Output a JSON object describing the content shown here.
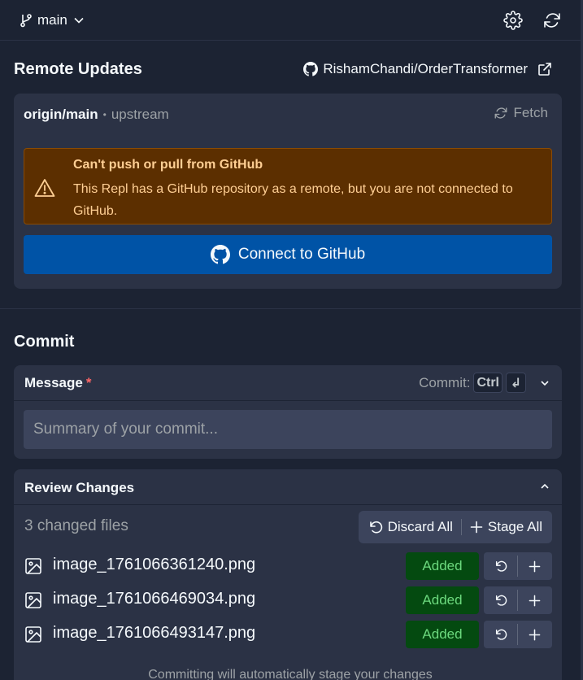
{
  "topbar": {
    "branch_name": "main",
    "icons": [
      "git-branch-icon",
      "chevron-down-icon",
      "gear-icon",
      "refresh-icon"
    ]
  },
  "remote": {
    "title": "Remote Updates",
    "repo_link": "RishamChandi/OrderTransformer",
    "origin": "origin/main",
    "separator": "•",
    "upstream": "upstream",
    "fetch_label": "Fetch",
    "warning_title": "Can't push or pull from GitHub",
    "warning_body": "This Repl has a GitHub repository as a remote, but you are not connected to GitHub.",
    "connect_label": "Connect to GitHub"
  },
  "commit": {
    "title": "Commit",
    "message_label": "Message",
    "required_mark": "*",
    "commit_hint": "Commit:",
    "shortcut_key": "Ctrl",
    "shortcut_enter": "↲",
    "message_placeholder": "Summary of your commit..."
  },
  "review": {
    "title": "Review Changes",
    "changed_count": "3 changed files",
    "discard_all": "Discard All",
    "stage_all": "Stage All",
    "files": [
      {
        "name": "image_1761066361240.png",
        "status": "Added"
      },
      {
        "name": "image_1761066469034.png",
        "status": "Added"
      },
      {
        "name": "image_1761066493147.png",
        "status": "Added"
      }
    ],
    "footer_note": "Committing will automatically stage your changes"
  },
  "colors": {
    "background": "#1c2333",
    "panel": "#2b3245",
    "warning_bg": "#5c2f00",
    "warning_text": "#ffcf94",
    "primary_button": "#0053a6",
    "added_badge_bg": "#044a10",
    "added_badge_text": "#6cd97e",
    "required": "#ff6666"
  }
}
